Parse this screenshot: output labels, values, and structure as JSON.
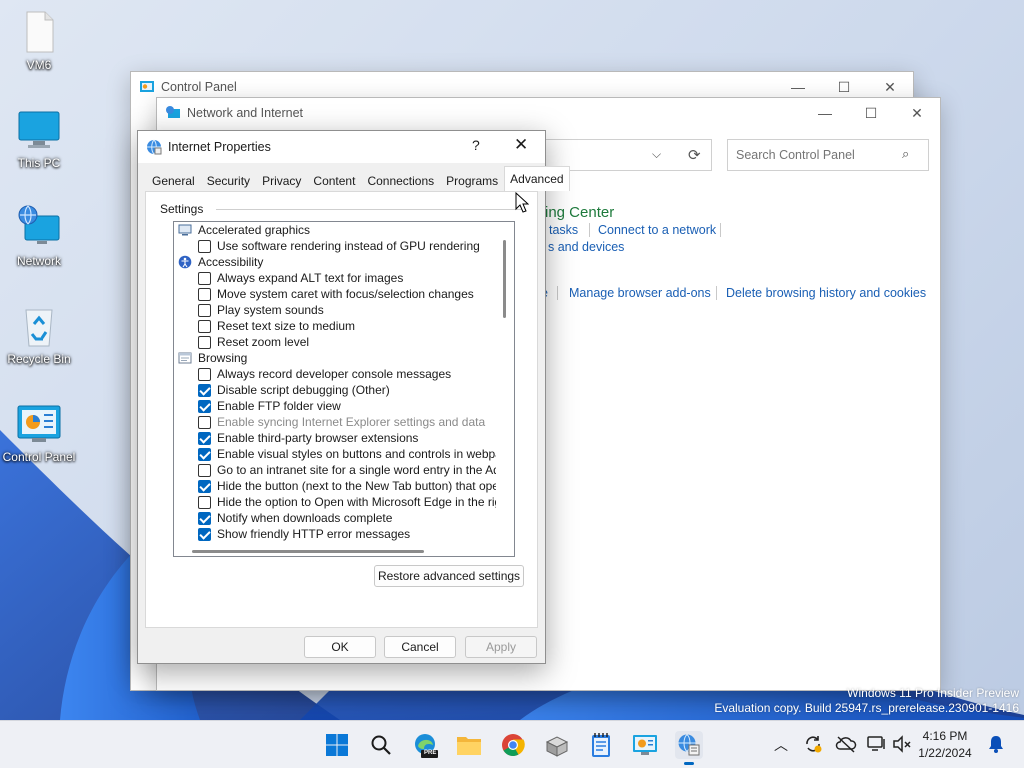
{
  "desktop": {
    "icons": [
      {
        "label": "VM6"
      },
      {
        "label": "This PC"
      },
      {
        "label": "Network"
      },
      {
        "label": "Recycle Bin"
      },
      {
        "label": "Control Panel"
      }
    ],
    "watermark_line1": "Windows 11 Pro Insider Preview",
    "watermark_line2": "Evaluation copy. Build 25947.rs_prerelease.230901-1416"
  },
  "control_panel_window": {
    "title": "Control Panel"
  },
  "network_window": {
    "title": "Network and Internet",
    "search_placeholder": "Search Control Panel",
    "heading_fragment": "ing Center",
    "link_tasks_fragment": "tasks",
    "link_connect": "Connect to a network",
    "link_devices_fragment": "s and devices",
    "link_sep_fragment": "e",
    "link_addons": "Manage browser add-ons",
    "link_history": "Delete browsing history and cookies"
  },
  "dialog": {
    "title": "Internet Properties",
    "help": "?",
    "close": "✕",
    "tabs": [
      "General",
      "Security",
      "Privacy",
      "Content",
      "Connections",
      "Programs",
      "Advanced"
    ],
    "active_tab": "Advanced",
    "settings_label": "Settings",
    "tree": [
      {
        "type": "cat",
        "icon": "monitor-icon",
        "label": "Accelerated graphics"
      },
      {
        "type": "opt",
        "checked": false,
        "label": "Use software rendering instead of GPU rendering"
      },
      {
        "type": "cat",
        "icon": "accessibility-icon",
        "label": "Accessibility"
      },
      {
        "type": "opt",
        "checked": false,
        "label": "Always expand ALT text for images"
      },
      {
        "type": "opt",
        "checked": false,
        "label": "Move system caret with focus/selection changes"
      },
      {
        "type": "opt",
        "checked": false,
        "label": "Play system sounds"
      },
      {
        "type": "opt",
        "checked": false,
        "label": "Reset text size to medium"
      },
      {
        "type": "opt",
        "checked": false,
        "label": "Reset zoom level"
      },
      {
        "type": "cat",
        "icon": "browser-page-icon",
        "label": "Browsing"
      },
      {
        "type": "opt",
        "checked": false,
        "label": "Always record developer console messages"
      },
      {
        "type": "opt",
        "checked": true,
        "label": "Disable script debugging (Other)"
      },
      {
        "type": "opt",
        "checked": true,
        "label": "Enable FTP folder view"
      },
      {
        "type": "opt",
        "checked": false,
        "disabled": true,
        "label": "Enable syncing Internet Explorer settings and data"
      },
      {
        "type": "opt",
        "checked": true,
        "label": "Enable third-party browser extensions"
      },
      {
        "type": "opt",
        "checked": true,
        "label": "Enable visual styles on buttons and controls in webpages"
      },
      {
        "type": "opt",
        "checked": false,
        "label": "Go to an intranet site for a single word entry in the Addres"
      },
      {
        "type": "opt",
        "checked": true,
        "label": "Hide the button (next to the New Tab button) that opens"
      },
      {
        "type": "opt",
        "checked": false,
        "label": "Hide the option to Open with Microsoft Edge in the right-cl"
      },
      {
        "type": "opt",
        "checked": true,
        "label": "Notify when downloads complete"
      },
      {
        "type": "opt",
        "checked": true,
        "label": "Show friendly HTTP error messages"
      }
    ],
    "restore_button": "Restore advanced settings",
    "ok_button": "OK",
    "cancel_button": "Cancel",
    "apply_button": "Apply"
  },
  "taskbar": {
    "time": "4:16 PM",
    "date": "1/22/2024",
    "edge_badge": "PRE"
  },
  "colors": {
    "accent": "#0067c0",
    "link": "#1a5fb4",
    "heading_green": "#1e7a3c"
  }
}
